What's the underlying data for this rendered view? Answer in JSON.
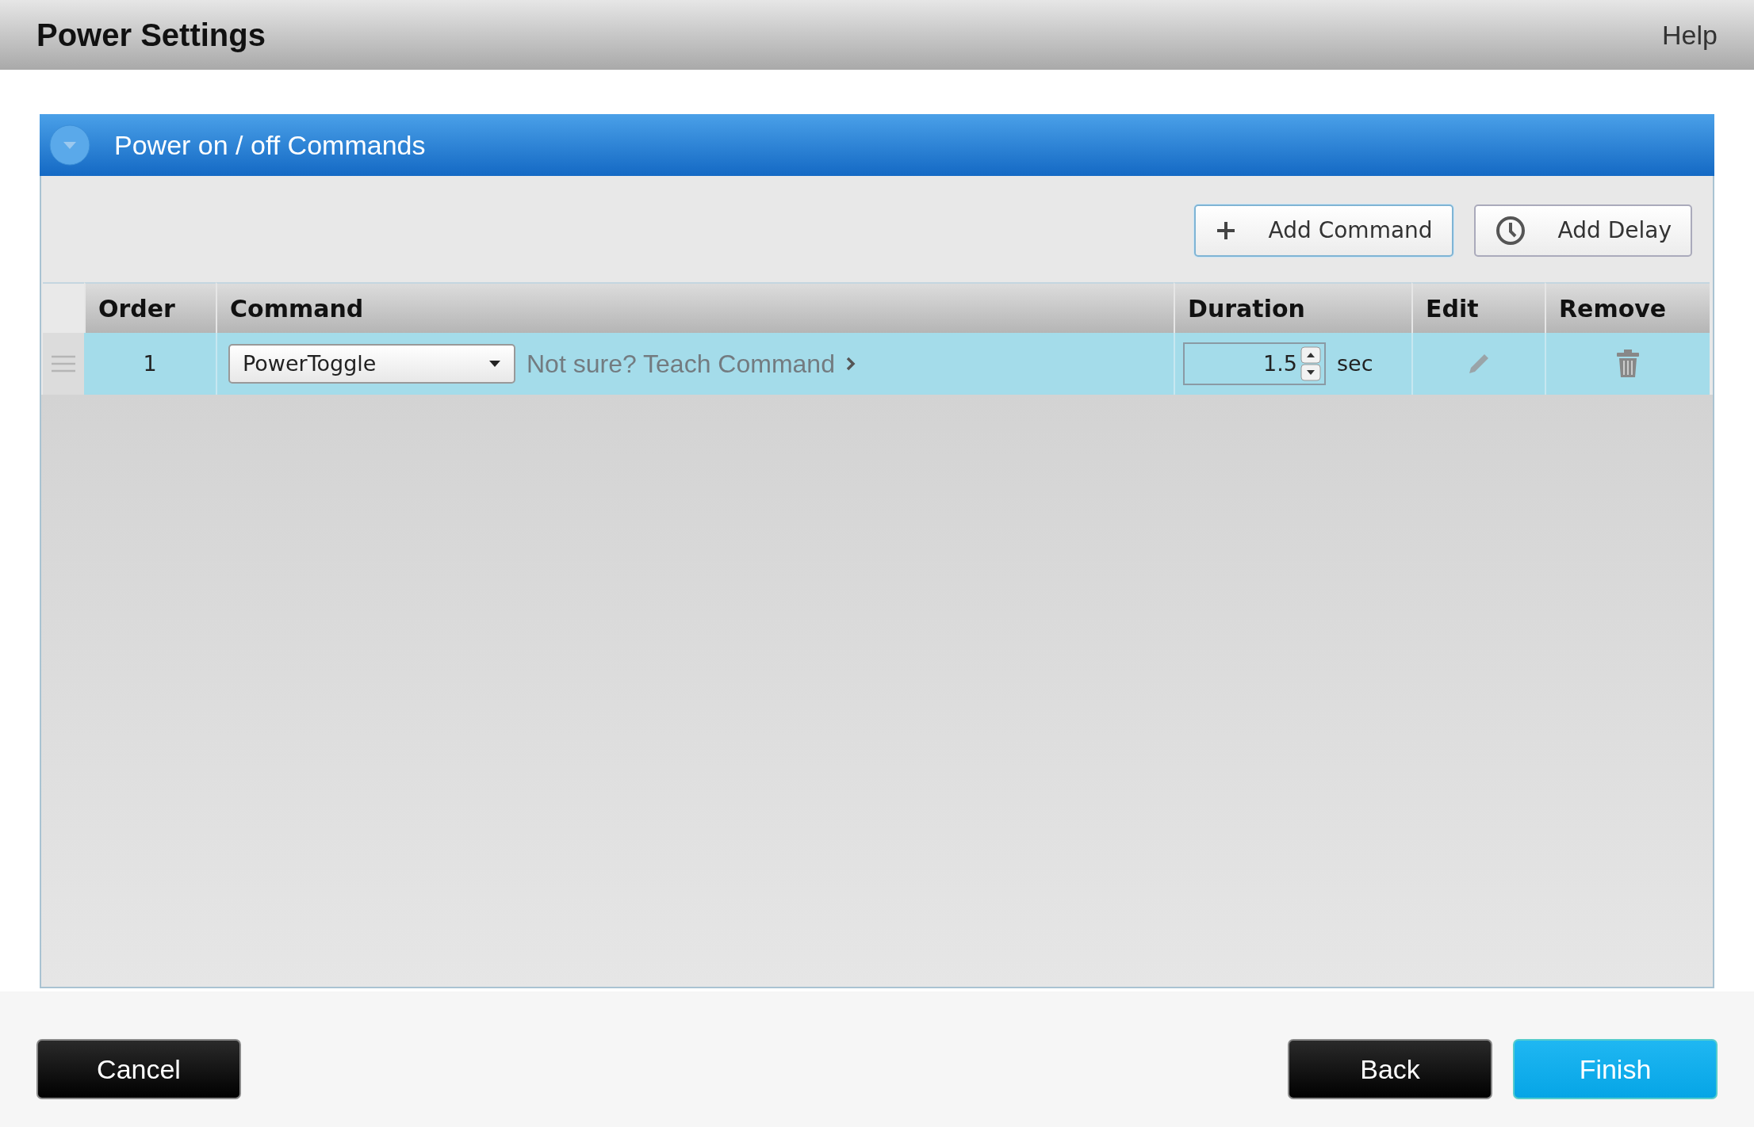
{
  "header": {
    "title": "Power Settings",
    "help": "Help"
  },
  "panel": {
    "title": "Power on / off Commands",
    "expanded": true,
    "toolbar": [
      {
        "label": "Add Command",
        "kind": "add"
      },
      {
        "label": "Add Delay",
        "kind": "delay"
      }
    ],
    "table": {
      "columns": [
        "Order",
        "Command",
        "Duration",
        "Edit",
        "Remove"
      ],
      "rows": [
        {
          "selected": true,
          "order": "1",
          "command": "PowerToggle",
          "teach_link": "Not sure? Teach Command",
          "duration": "1.5",
          "unit": "sec"
        }
      ]
    }
  },
  "footer": {
    "buttons": [
      {
        "label": "Cancel",
        "kind": "dark"
      },
      {
        "label": "Back",
        "kind": "dark"
      },
      {
        "label": "Finish",
        "kind": "primary"
      }
    ]
  }
}
